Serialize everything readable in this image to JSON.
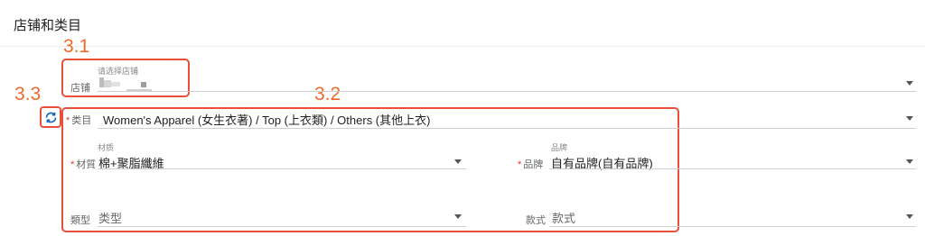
{
  "header": {
    "title": "店铺和类目"
  },
  "annotations": {
    "a1": "3.1",
    "a2": "3.2",
    "a3": "3.3"
  },
  "store": {
    "label": "店铺",
    "hint": "请选择店铺"
  },
  "category": {
    "label": "类目",
    "value": "Women's Apparel (女生衣著) / Top (上衣類) / Others (其他上衣)"
  },
  "material": {
    "label": "材質",
    "hint": "材质",
    "value": "棉+聚脂纖維"
  },
  "brand": {
    "label": "品牌",
    "hint": "品牌",
    "value": "自有品牌(自有品牌)"
  },
  "type": {
    "label": "類型",
    "placeholder": "类型"
  },
  "style": {
    "label": "款式",
    "placeholder": "款式"
  },
  "colors": {
    "accent": "#e8503a",
    "annotation": "#ee6a2b",
    "required": "#e53935"
  },
  "icons": {
    "refresh": "refresh-icon",
    "dropdown": "caret-down-icon"
  }
}
